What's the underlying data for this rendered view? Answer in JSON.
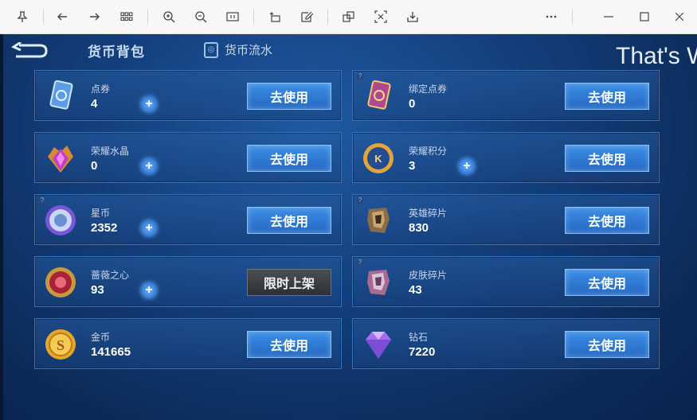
{
  "game": {
    "tab_active": "货币背包",
    "tab_flow": "货币流水",
    "overlay_text": "That's W"
  },
  "currencies": [
    {
      "name": "点券",
      "value": "4",
      "button": "去使用",
      "icon": "voucher-card-icon"
    },
    {
      "name": "绑定点券",
      "value": "0",
      "button": "去使用",
      "icon": "bound-voucher-card-icon"
    },
    {
      "name": "荣耀水晶",
      "value": "0",
      "button": "去使用",
      "icon": "glory-crystal-icon"
    },
    {
      "name": "荣耀积分",
      "value": "3",
      "button": "去使用",
      "icon": "glory-points-icon"
    },
    {
      "name": "星币",
      "value": "2352",
      "button": "去使用",
      "icon": "star-coin-icon"
    },
    {
      "name": "英雄碎片",
      "value": "830",
      "button": "去使用",
      "icon": "hero-fragment-icon"
    },
    {
      "name": "蔷薇之心",
      "value": "93",
      "button": "限时上架",
      "icon": "rose-heart-icon"
    },
    {
      "name": "皮肤碎片",
      "value": "43",
      "button": "去使用",
      "icon": "skin-fragment-icon"
    },
    {
      "name": "金币",
      "value": "141665",
      "button": "去使用",
      "icon": "gold-coin-icon"
    },
    {
      "name": "钻石",
      "value": "7220",
      "button": "去使用",
      "icon": "diamond-icon"
    }
  ],
  "colors": {
    "accent_blue": "#2f79d6",
    "card_border": "#3a72b7"
  }
}
